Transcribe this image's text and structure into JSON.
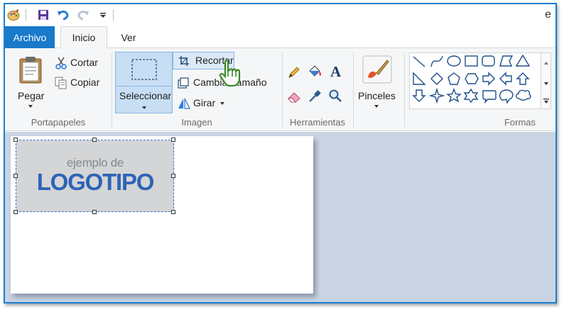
{
  "window": {
    "title_fragment": "e"
  },
  "tabs": {
    "file": "Archivo",
    "home": "Inicio",
    "view": "Ver"
  },
  "clipboard": {
    "paste": "Pegar",
    "cut": "Cortar",
    "copy": "Copiar",
    "group_label": "Portapapeles"
  },
  "image": {
    "select": "Seleccionar",
    "crop": "Recortar",
    "resize": "Cambiar tamaño",
    "rotate": "Girar",
    "group_label": "Imagen"
  },
  "tools": {
    "group_label": "Herramientas"
  },
  "brushes": {
    "label": "Pinceles"
  },
  "shapes": {
    "group_label": "Formas",
    "items": [
      "line",
      "curve",
      "oval",
      "rectangle",
      "rounded-rectangle",
      "polygon",
      "triangle",
      "right-triangle",
      "diamond",
      "pentagon",
      "hexagon",
      "right-arrow",
      "left-arrow",
      "up-arrow",
      "down-arrow",
      "four-point-star",
      "five-point-star",
      "six-point-star",
      "rounded-callout",
      "oval-callout",
      "cloud-callout"
    ]
  },
  "canvas": {
    "logo_line1": "ejemplo de",
    "logo_line2": "LOGOTIPO"
  },
  "colors": {
    "accent": "#1979ca",
    "logo_blue": "#2d64b8",
    "workspace": "#c9d3e2",
    "selection_fill": "#c8def4"
  }
}
